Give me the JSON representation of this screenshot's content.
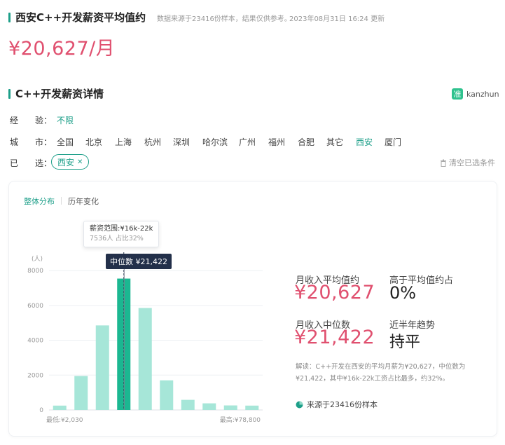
{
  "header": {
    "title": "西安C++开发薪资平均值约",
    "source_note": "数据来源于23416份样本，结果仅供参考。",
    "updated": "2023年08月31日 16:24 更新",
    "avg_salary": "¥20,627/月"
  },
  "details": {
    "title": "C++开发薪资详情",
    "brand_logo": "准",
    "brand_name": "kanzhun",
    "experience_label": "经　　验：",
    "experience_value": "不限",
    "city_label": "城　　市：",
    "cities": [
      "全国",
      "北京",
      "上海",
      "杭州",
      "深圳",
      "哈尔滨",
      "广州",
      "福州",
      "合肥",
      "其它",
      "西安",
      "厦门"
    ],
    "active_city": "西安",
    "selected_label": "已　　选：",
    "selected_chip": "西安",
    "clear_label": "清空已选条件"
  },
  "tabs": {
    "overall": "整体分布",
    "history": "历年变化"
  },
  "tooltip": {
    "range": "薪资范围:¥16k-22k",
    "detail": "7536人  占比32%"
  },
  "median_label": "中位数 ¥21,422",
  "stats": {
    "avg_label": "月收入平均值约",
    "avg_value": "¥20,627",
    "above_label": "高于平均值约占",
    "above_value": "0%",
    "median_label": "月收入中位数",
    "median_value": "¥21,422",
    "trend_label": "近半年趋势",
    "trend_value": "持平",
    "note": "解读：C++开发在西安的平均月薪为¥20,627，中位数为¥21,422，其中¥16k-22k工资占比最多，约32%。",
    "source": "来源于23416份样本"
  },
  "colors": {
    "accent": "#1d9f89",
    "price": "#e0506f",
    "bar_light": "#a6e6d8",
    "bar_highlight": "#1bb791"
  },
  "chart_data": {
    "type": "bar",
    "y_unit": "(人)",
    "y_ticks": [
      "0",
      "2000",
      "4000",
      "6000",
      "8000"
    ],
    "ylim": [
      0,
      8000
    ],
    "values": [
      250,
      1950,
      4850,
      7536,
      5850,
      1700,
      580,
      380,
      260,
      250
    ],
    "highlight_index": 3,
    "median_position": 3.5,
    "x_min_label": "最低:¥2,030",
    "x_max_label": "最高:¥78,800"
  }
}
